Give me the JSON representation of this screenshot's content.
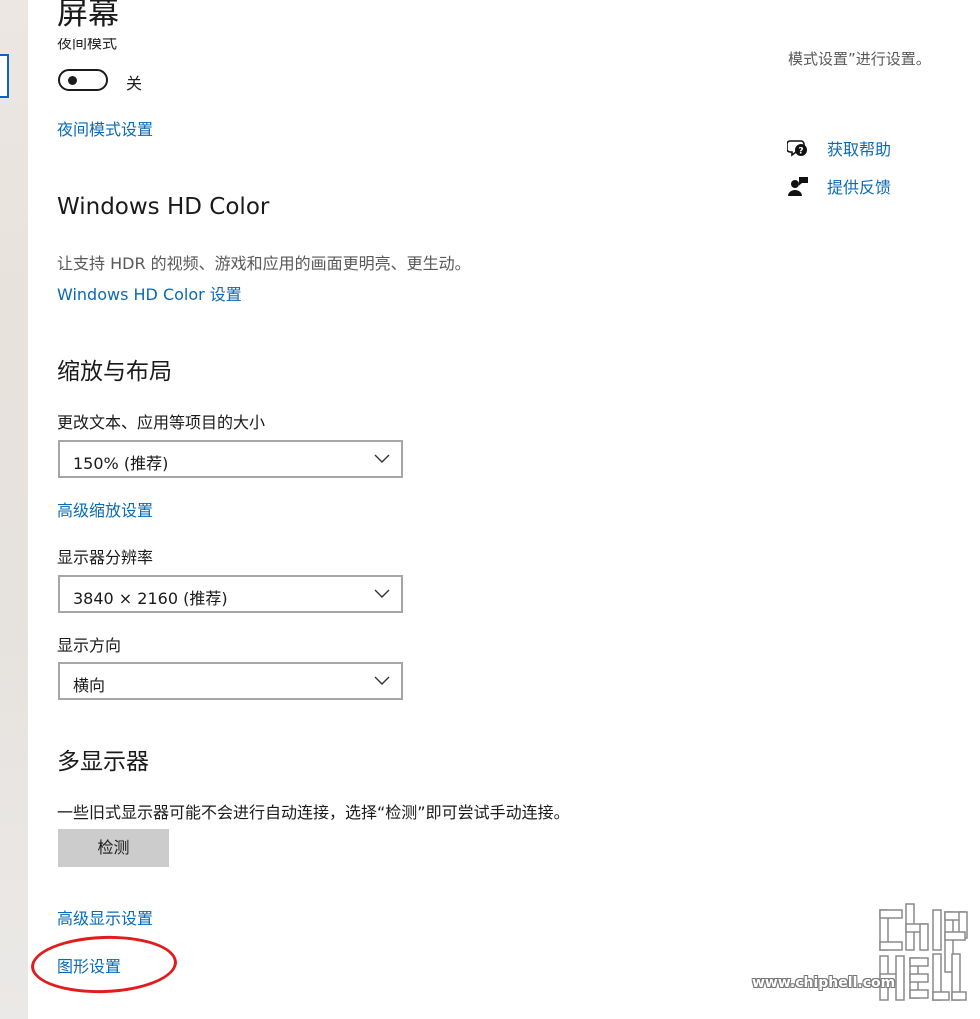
{
  "page": {
    "title": "屏幕"
  },
  "night_mode": {
    "label": "夜间模式",
    "toggle_state": "关",
    "settings_link": "夜间模式设置"
  },
  "hd_color": {
    "heading": "Windows HD Color",
    "description": "让支持 HDR 的视频、游戏和应用的画面更明亮、更生动。",
    "settings_link": "Windows HD Color 设置"
  },
  "scale_layout": {
    "heading": "缩放与布局",
    "scale_label": "更改文本、应用等项目的大小",
    "scale_value": "150% (推荐)",
    "advanced_scaling_link": "高级缩放设置",
    "resolution_label": "显示器分辨率",
    "resolution_value": "3840 × 2160 (推荐)",
    "orientation_label": "显示方向",
    "orientation_value": "横向"
  },
  "multi_display": {
    "heading": "多显示器",
    "description": "一些旧式显示器可能不会进行自动连接，选择“检测”即可尝试手动连接。",
    "detect_button": "检测",
    "advanced_display_link": "高级显示设置",
    "graphics_settings_link": "图形设置"
  },
  "right_panel": {
    "note": "模式设置”进行设置。",
    "get_help": "获取帮助",
    "give_feedback": "提供反馈"
  },
  "watermark": {
    "url": "www.chiphell.com"
  },
  "colors": {
    "link": "#0b6ab5",
    "annotation": "#e11c1c",
    "button": "#cccccc"
  }
}
